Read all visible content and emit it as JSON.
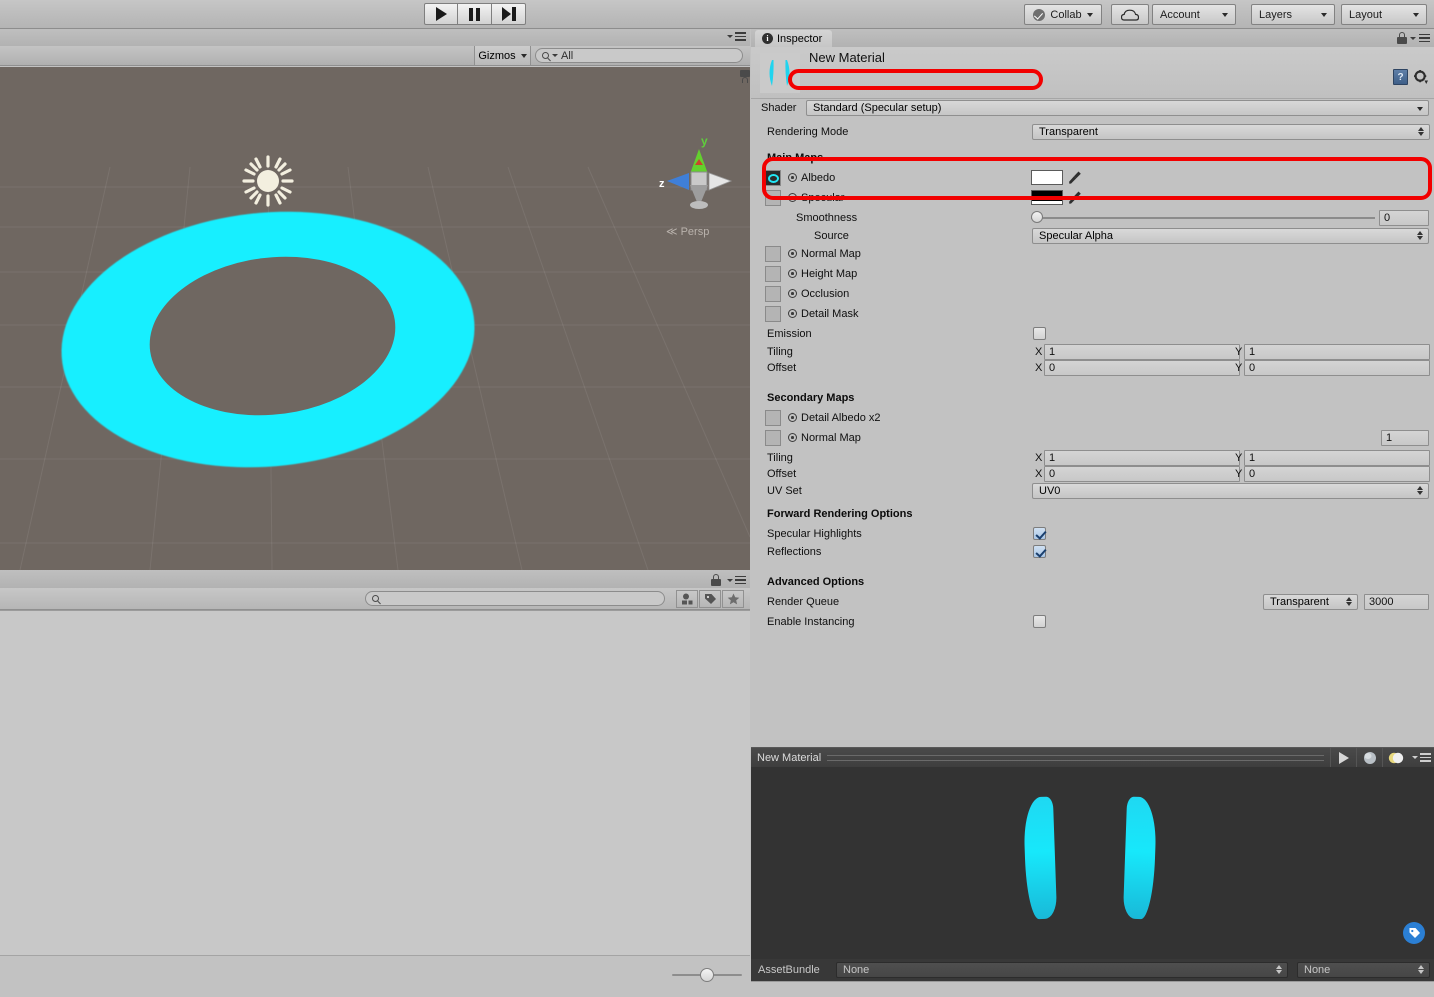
{
  "toolbar": {
    "collab_label": "Collab",
    "cloud_label": "",
    "account_label": "Account",
    "layers_label": "Layers",
    "layout_label": "Layout"
  },
  "scene": {
    "gizmos_label": "Gizmos",
    "search_value": "All",
    "search_placeholder": "All",
    "persp_label": "Persp",
    "axis_y": "y",
    "axis_z": "z",
    "ground_color": "#6f6761",
    "object_color": "#17efff"
  },
  "project": {
    "search_value": "",
    "search_placeholder": ""
  },
  "inspector": {
    "tab_label": "Inspector",
    "material_name": "New Material",
    "shader": {
      "label": "Shader",
      "value": "Standard (Specular setup)"
    },
    "rendering_mode": {
      "label": "Rendering Mode",
      "value": "Transparent"
    },
    "main_maps": {
      "header": "Main Maps",
      "albedo_label": "Albedo",
      "albedo_color": "#ffffff",
      "specular_label": "Specular",
      "specular_color": "#000000",
      "smoothness_label": "Smoothness",
      "smoothness_value": "0",
      "source_label": "Source",
      "source_value": "Specular Alpha",
      "normal_map_label": "Normal Map",
      "height_map_label": "Height Map",
      "occlusion_label": "Occlusion",
      "detail_mask_label": "Detail Mask",
      "emission_label": "Emission",
      "tiling_label": "Tiling",
      "tiling_x_label": "X",
      "tiling_x": "1",
      "tiling_y_label": "Y",
      "tiling_y": "1",
      "offset_label": "Offset",
      "offset_x_label": "X",
      "offset_x": "0",
      "offset_y_label": "Y",
      "offset_y": "0"
    },
    "secondary_maps": {
      "header": "Secondary Maps",
      "detail_albedo_label": "Detail Albedo x2",
      "normal_map_label": "Normal Map",
      "normal_map_value": "1",
      "tiling_label": "Tiling",
      "tiling_x_label": "X",
      "tiling_x": "1",
      "tiling_y_label": "Y",
      "tiling_y": "1",
      "offset_label": "Offset",
      "offset_x_label": "X",
      "offset_x": "0",
      "offset_y_label": "Y",
      "offset_y": "0",
      "uv_set_label": "UV Set",
      "uv_set_value": "UV0"
    },
    "forward_rendering": {
      "header": "Forward Rendering Options",
      "specular_highlights_label": "Specular Highlights",
      "reflections_label": "Reflections"
    },
    "advanced": {
      "header": "Advanced Options",
      "render_queue_label": "Render Queue",
      "render_queue_mode": "Transparent",
      "render_queue_value": "3000",
      "enable_instancing_label": "Enable Instancing"
    }
  },
  "preview": {
    "title": "New Material",
    "assetbundle_label": "AssetBundle",
    "assetbundle_value": "None",
    "assetbundle_variant": "None"
  },
  "annotations": {
    "highlight_color": "#f20000"
  }
}
